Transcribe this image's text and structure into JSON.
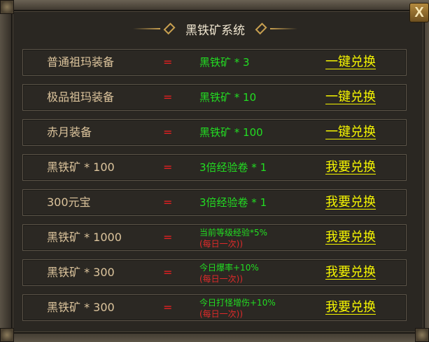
{
  "window": {
    "title": "黑铁矿系统",
    "close_label": "X"
  },
  "rows": [
    {
      "item": "普通祖玛装备",
      "eq": "=",
      "result": "黑铁矿 * 3",
      "note": "",
      "action": "一键兑换"
    },
    {
      "item": "极品祖玛装备",
      "eq": "=",
      "result": "黑铁矿 * 10",
      "note": "",
      "action": "一键兑换"
    },
    {
      "item": "赤月装备",
      "eq": "=",
      "result": "黑铁矿 * 100",
      "note": "",
      "action": "一键兑换"
    },
    {
      "item": "黑铁矿 * 100",
      "eq": "=",
      "result": "3倍经验卷 * 1",
      "note": "",
      "action": "我要兑换"
    },
    {
      "item": "300元宝",
      "eq": "=",
      "result": "3倍经验卷 * 1",
      "note": "",
      "action": "我要兑换"
    },
    {
      "item": "黑铁矿 * 1000",
      "eq": "=",
      "result": "当前等级经验*5%",
      "note": "(每日一次))",
      "action": "我要兑换"
    },
    {
      "item": "黑铁矿 * 300",
      "eq": "=",
      "result": "今日爆率+10%",
      "note": "(每日一次))",
      "action": "我要兑换"
    },
    {
      "item": "黑铁矿 * 300",
      "eq": "=",
      "result": "今日打怪增伤+10%",
      "note": "(每日一次))",
      "action": "我要兑换"
    }
  ],
  "colors": {
    "item_text": "#dcc49c",
    "equals": "#e02020",
    "reward": "#22dd22",
    "note": "#e02a2a",
    "action": "#f5f500"
  }
}
